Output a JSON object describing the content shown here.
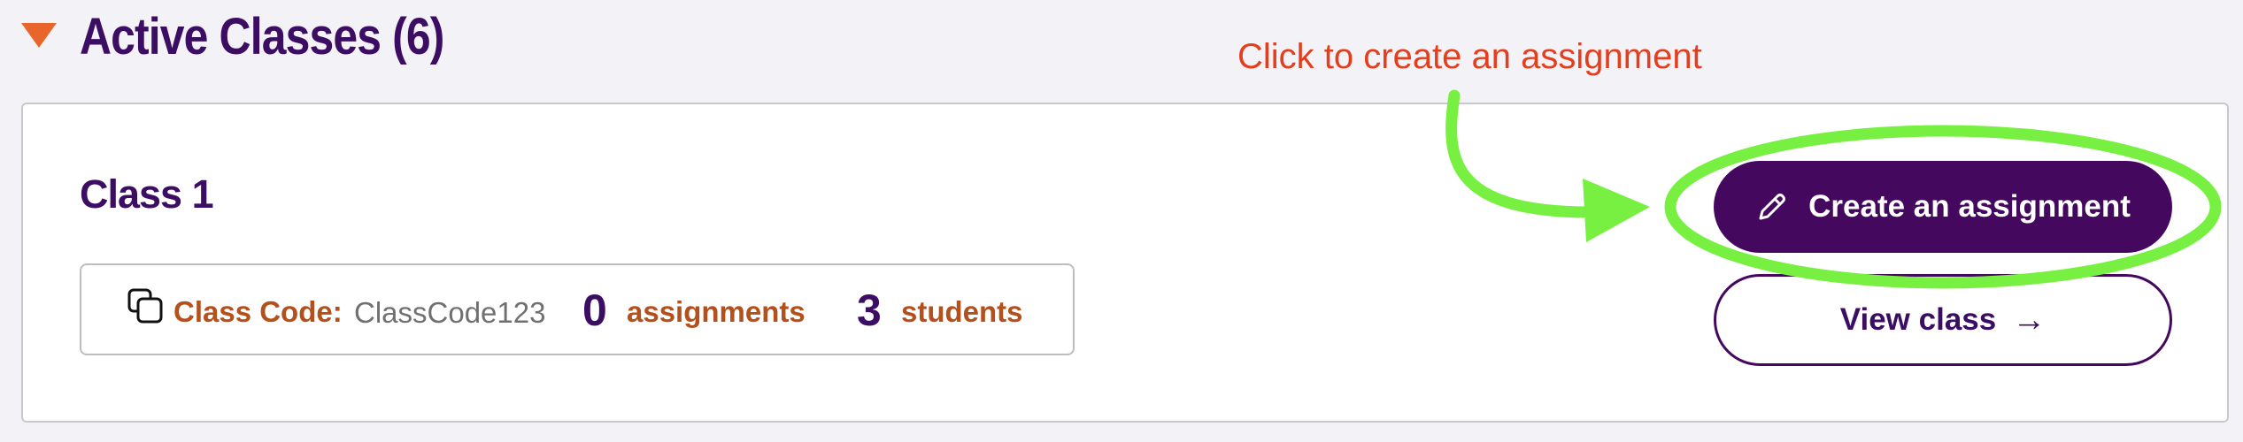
{
  "section": {
    "title": "Active Classes (6)"
  },
  "annotation": {
    "text": "Click to create an assignment"
  },
  "class_card": {
    "name": "Class 1",
    "code_label": "Class Code:",
    "code_value": "ClassCode123",
    "assignments_count": "0",
    "assignments_label": "assignments",
    "students_count": "3",
    "students_label": "students"
  },
  "buttons": {
    "create_label": "Create an assignment",
    "view_label": "View class",
    "view_arrow": "→"
  },
  "colors": {
    "brand_purple": "#45085f",
    "accent_orange": "#e8662b",
    "label_orange": "#b4501c",
    "annotation_red": "#e53e1f",
    "highlight_green": "#77f041"
  },
  "icons": [
    "caret-down-icon",
    "copy-icon",
    "pencil-icon",
    "arrow-right-icon"
  ]
}
